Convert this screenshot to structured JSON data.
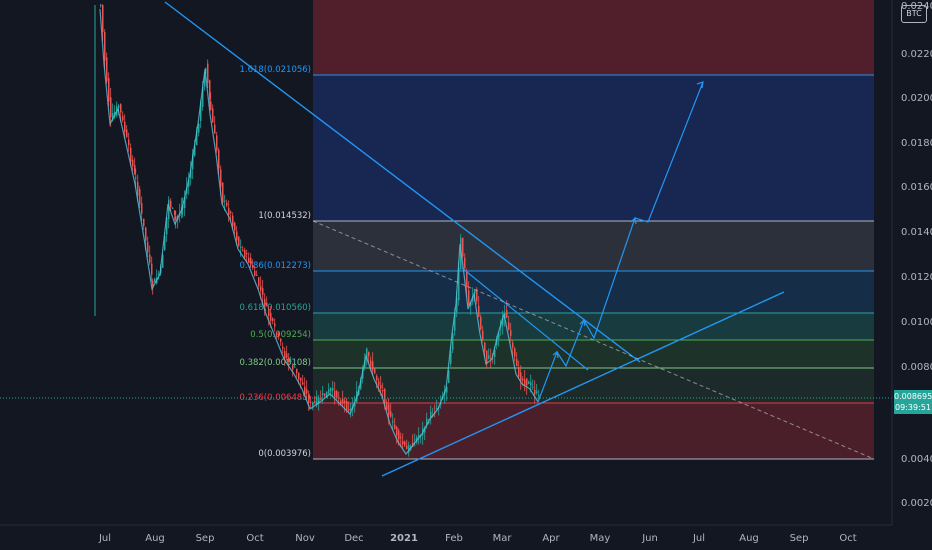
{
  "symbol_badge": "BTC",
  "last_price": "0.008695",
  "countdown": "09:39:51",
  "x_labels": [
    "Jul",
    "Aug",
    "Sep",
    "Oct",
    "Nov",
    "Dec",
    "2021",
    "Feb",
    "Mar",
    "Apr",
    "May",
    "Jun",
    "Jul",
    "Aug",
    "Sep",
    "Oct"
  ],
  "y_labels": [
    "0.024000",
    "0.022000",
    "0.020000",
    "0.018000",
    "0.016000",
    "0.014000",
    "0.012000",
    "0.010000",
    "0.008000",
    "0.006000",
    "0.004000",
    "0.002000"
  ],
  "fib_levels": [
    {
      "label": "1.618(0.021056)",
      "value": 0.021056,
      "color": "#2196f3"
    },
    {
      "label": "1(0.014532)",
      "value": 0.014532,
      "color": "#b2b5be"
    },
    {
      "label": "0.786(0.012273)",
      "value": 0.012273,
      "color": "#2196f3"
    },
    {
      "label": "0.618(0.010560)",
      "value": 0.01056,
      "color": "#26a69a"
    },
    {
      "label": "0.5(0.009254)",
      "value": 0.009254,
      "color": "#4caf50"
    },
    {
      "label": "0.382(0.008108)",
      "value": 0.008108,
      "color": "#81c784"
    },
    {
      "label": "0.236(0.006485)",
      "value": 0.006485,
      "color": "#f23645"
    },
    {
      "label": "0(0.003976)",
      "value": 0.003976,
      "color": "#b2b5be"
    }
  ],
  "colors": {
    "background": "#131722",
    "up_candle": "#26a69a",
    "down_candle": "#ef5350",
    "trendline": "#2196f3",
    "ma_line": "#5bc0de"
  }
}
